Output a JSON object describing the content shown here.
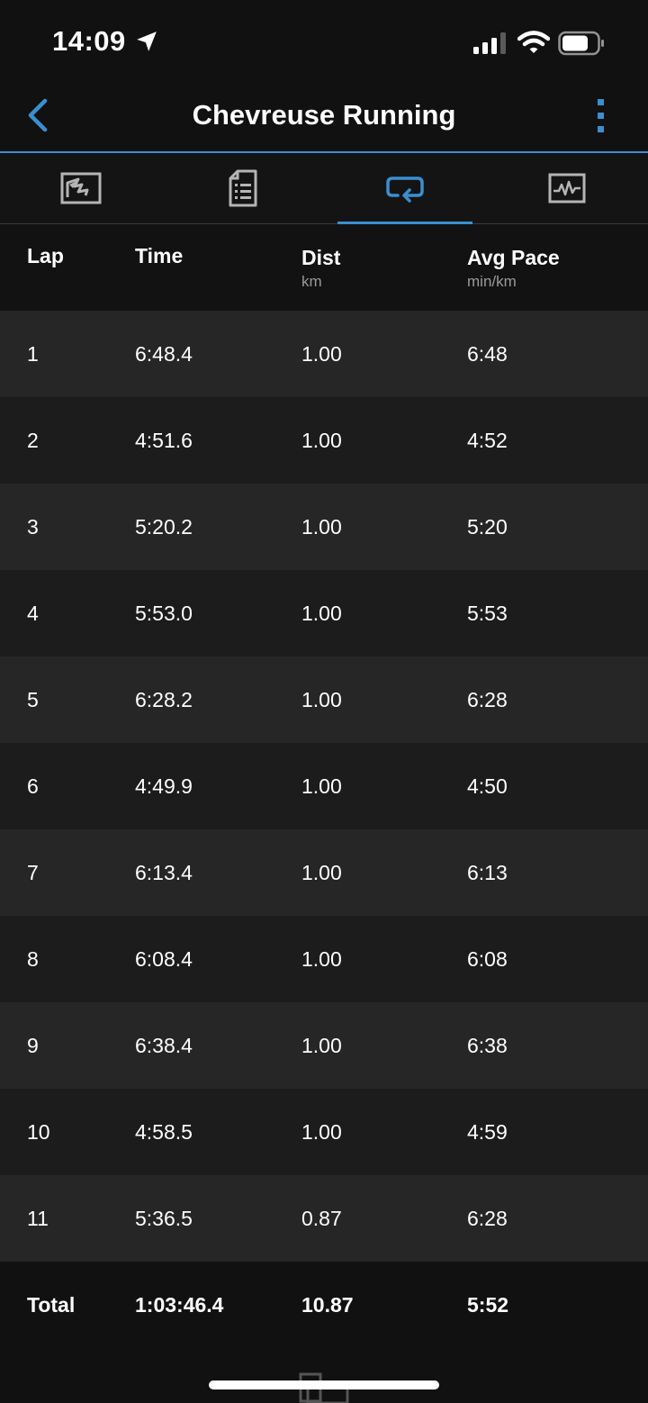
{
  "status_bar": {
    "time": "14:09"
  },
  "nav": {
    "title": "Chevreuse Running"
  },
  "tabs": [
    {
      "icon": "map-icon",
      "active": false
    },
    {
      "icon": "details-icon",
      "active": false
    },
    {
      "icon": "laps-icon",
      "active": true
    },
    {
      "icon": "charts-icon",
      "active": false
    }
  ],
  "table": {
    "headers": {
      "lap": "Lap",
      "time": "Time",
      "dist": "Dist",
      "dist_unit": "km",
      "pace": "Avg Pace",
      "pace_unit": "min/km"
    },
    "rows": [
      {
        "lap": "1",
        "time": "6:48.4",
        "dist": "1.00",
        "pace": "6:48"
      },
      {
        "lap": "2",
        "time": "4:51.6",
        "dist": "1.00",
        "pace": "4:52"
      },
      {
        "lap": "3",
        "time": "5:20.2",
        "dist": "1.00",
        "pace": "5:20"
      },
      {
        "lap": "4",
        "time": "5:53.0",
        "dist": "1.00",
        "pace": "5:53"
      },
      {
        "lap": "5",
        "time": "6:28.2",
        "dist": "1.00",
        "pace": "6:28"
      },
      {
        "lap": "6",
        "time": "4:49.9",
        "dist": "1.00",
        "pace": "4:50"
      },
      {
        "lap": "7",
        "time": "6:13.4",
        "dist": "1.00",
        "pace": "6:13"
      },
      {
        "lap": "8",
        "time": "6:08.4",
        "dist": "1.00",
        "pace": "6:08"
      },
      {
        "lap": "9",
        "time": "6:38.4",
        "dist": "1.00",
        "pace": "6:38"
      },
      {
        "lap": "10",
        "time": "4:58.5",
        "dist": "1.00",
        "pace": "4:59"
      },
      {
        "lap": "11",
        "time": "5:36.5",
        "dist": "0.87",
        "pace": "6:28"
      }
    ],
    "total": {
      "label": "Total",
      "time": "1:03:46.4",
      "dist": "10.87",
      "pace": "5:52"
    }
  },
  "colors": {
    "accent": "#3a8fd0",
    "background": "#111111",
    "row_odd": "#262626",
    "row_even": "#1c1c1c"
  }
}
